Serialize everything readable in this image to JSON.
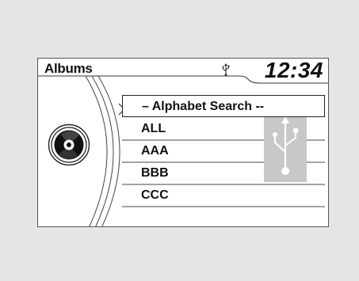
{
  "header": {
    "title": "Albums",
    "clock": "12:34",
    "usb_icon": "usb-icon"
  },
  "list": {
    "items": [
      {
        "label": "– Alphabet Search --",
        "selected": true
      },
      {
        "label": "ALL",
        "selected": false
      },
      {
        "label": "AAA",
        "selected": false
      },
      {
        "label": "BBB",
        "selected": false
      },
      {
        "label": "CCC",
        "selected": false
      }
    ]
  },
  "icons": {
    "disc": "disc-icon",
    "usb_badge": "usb-icon",
    "selection_arrow": "chevron-right-icon"
  },
  "colors": {
    "background": "#e5e5e5",
    "screen": "#ffffff",
    "text": "#111111",
    "badge": "#c8c8c8"
  }
}
